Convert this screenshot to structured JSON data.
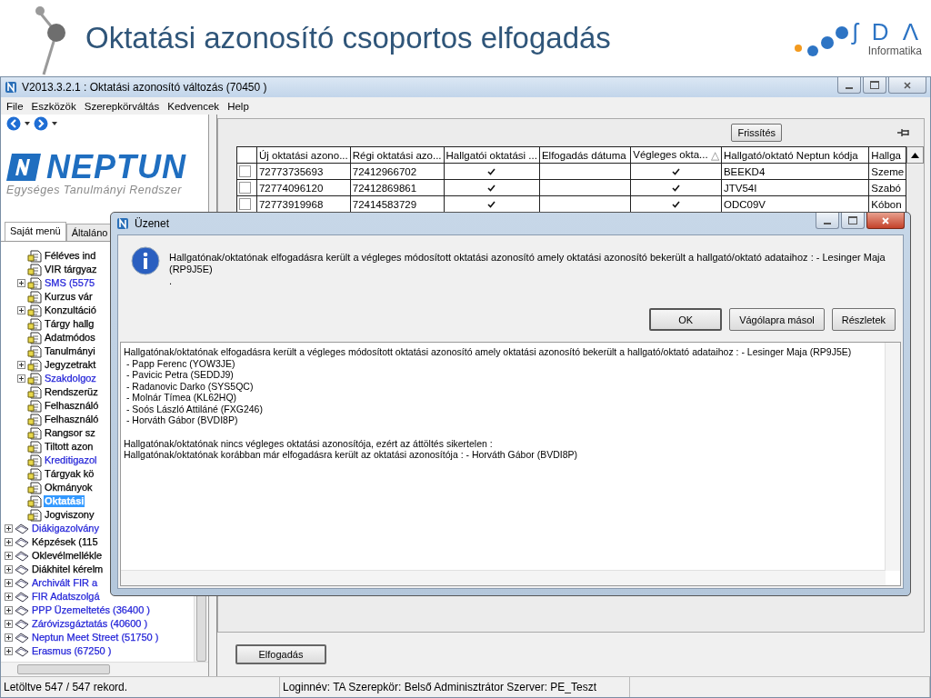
{
  "slide": {
    "title": "Oktatási azonosító csoportos elfogadás",
    "logo": {
      "letters": "ʃ D Λ",
      "subtitle": "Informatika"
    }
  },
  "window": {
    "title": "V2013.3.2.1 : Oktatási azonosító változás (70450  )",
    "menu": [
      "File",
      "Eszközök",
      "Szerepkörváltás",
      "Kedvencek",
      "Help"
    ]
  },
  "sidebar": {
    "brand": "NEPTUN",
    "tagline": "Egységes Tanulmányi Rendszer",
    "tabs": [
      {
        "label": "Saját menü",
        "selected": true
      },
      {
        "label": "Általáno",
        "selected": false
      }
    ],
    "tree": [
      {
        "kind": "menu",
        "label": "Féléves ind",
        "color": "#000000",
        "expandable": false,
        "selected": false
      },
      {
        "kind": "menu",
        "label": "VIR tárgyaz",
        "color": "#000000",
        "expandable": false,
        "selected": false
      },
      {
        "kind": "menu",
        "label": "SMS (5575",
        "color": "#2424d8",
        "expandable": true,
        "selected": false
      },
      {
        "kind": "menu",
        "label": "Kurzus vár",
        "color": "#000000",
        "expandable": false,
        "selected": false
      },
      {
        "kind": "menu",
        "label": "Konzultáció",
        "color": "#000000",
        "expandable": true,
        "selected": false
      },
      {
        "kind": "menu",
        "label": "Tárgy hallg",
        "color": "#000000",
        "expandable": false,
        "selected": false
      },
      {
        "kind": "menu",
        "label": "Adatmódos",
        "color": "#000000",
        "expandable": false,
        "selected": false
      },
      {
        "kind": "menu",
        "label": "Tanulmányi",
        "color": "#000000",
        "expandable": false,
        "selected": false
      },
      {
        "kind": "menu",
        "label": "Jegyzetrakt",
        "color": "#000000",
        "expandable": true,
        "selected": false
      },
      {
        "kind": "menu",
        "label": "Szakdolgoz",
        "color": "#2424d8",
        "expandable": true,
        "selected": false
      },
      {
        "kind": "menu",
        "label": "Rendszerüz",
        "color": "#000000",
        "expandable": false,
        "selected": false
      },
      {
        "kind": "menu",
        "label": "Felhasználó",
        "color": "#000000",
        "expandable": false,
        "selected": false
      },
      {
        "kind": "menu",
        "label": "Felhasználó",
        "color": "#000000",
        "expandable": false,
        "selected": false
      },
      {
        "kind": "menu",
        "label": "Rangsor sz",
        "color": "#000000",
        "expandable": false,
        "selected": false
      },
      {
        "kind": "menu",
        "label": "Tiltott azon",
        "color": "#000000",
        "expandable": false,
        "selected": false
      },
      {
        "kind": "menu",
        "label": "Kreditigazol",
        "color": "#2424d8",
        "expandable": false,
        "selected": false
      },
      {
        "kind": "menu",
        "label": "Tárgyak kö",
        "color": "#000000",
        "expandable": false,
        "selected": false
      },
      {
        "kind": "menu",
        "label": "Okmányok",
        "color": "#000000",
        "expandable": false,
        "selected": false
      },
      {
        "kind": "menu",
        "label": "Oktatási",
        "expandable": false,
        "selected": true
      },
      {
        "kind": "menu",
        "label": "Jogviszony",
        "color": "#000000",
        "expandable": false,
        "selected": false
      },
      {
        "kind": "module",
        "label": "Diákigazolvány",
        "color": "#2424d8",
        "expandable": true,
        "selected": false
      },
      {
        "kind": "module",
        "label": "Képzések (115",
        "color": "#000000",
        "expandable": true,
        "selected": false
      },
      {
        "kind": "module",
        "label": "Oklevélmellékle",
        "color": "#000000",
        "expandable": true,
        "selected": false
      },
      {
        "kind": "module",
        "label": "Diákhitel kérelm",
        "color": "#000000",
        "expandable": true,
        "selected": false
      },
      {
        "kind": "module",
        "label": "Archivált FIR a",
        "color": "#2424d8",
        "expandable": true,
        "selected": false
      },
      {
        "kind": "module",
        "label": "FIR Adatszolgá",
        "color": "#2424d8",
        "expandable": true,
        "selected": false
      },
      {
        "kind": "module",
        "label": "PPP Üzemeltetés (36400  )",
        "color": "#2424d8",
        "expandable": true,
        "selected": false
      },
      {
        "kind": "module",
        "label": "Záróvizsgáztatás (40600  )",
        "color": "#2424d8",
        "expandable": true,
        "selected": false
      },
      {
        "kind": "module",
        "label": "Neptun Meet Street (51750  )",
        "color": "#2424d8",
        "expandable": true,
        "selected": false
      },
      {
        "kind": "module",
        "label": "Erasmus (67250  )",
        "color": "#2424d8",
        "expandable": true,
        "selected": false
      }
    ]
  },
  "toolbar": {
    "refresh_button": "Frissítés"
  },
  "table": {
    "columns": [
      {
        "kind": "select"
      },
      {
        "kind": "text",
        "label": "Új oktatási azono..."
      },
      {
        "kind": "text",
        "label": "Régi oktatási azo..."
      },
      {
        "kind": "text",
        "label": "Hallgatói oktatási ..."
      },
      {
        "kind": "text",
        "label": "Elfogadás dátuma"
      },
      {
        "kind": "text",
        "label": "Végleges okta...",
        "sort_mark": "△"
      },
      {
        "kind": "text",
        "label": "Hallgató/oktató Neptun kódja"
      },
      {
        "kind": "text",
        "label": "Hallga"
      }
    ],
    "rows": [
      {
        "checked": false,
        "new_id": "72773735693",
        "old_id": "72412966702",
        "student_id_ok": true,
        "final": true,
        "code": "BEEKD4",
        "column_8": "Szeme"
      },
      {
        "checked": false,
        "new_id": "72774096120",
        "old_id": "72412869861",
        "student_id_ok": true,
        "final": true,
        "code": "JTV54I",
        "column_8": "Szabó"
      },
      {
        "checked": false,
        "new_id": "72773919968",
        "old_id": "72414583729",
        "student_id_ok": true,
        "final": true,
        "code": "ODC09V",
        "column_8": "Kóbon"
      }
    ]
  },
  "accept_button": "Elfogadás",
  "status_bar": {
    "records": "Letöltve 547 / 547 rekord.",
    "session": "Loginnév: TA   Szerepkör: Belső Adminisztrátor   Szerver: PE_Teszt"
  },
  "dialog": {
    "title": "Üzenet",
    "message": "Hallgatónak/oktatónak elfogadásra került a végleges módosított oktatási azonosító amely oktatási azonosító bekerült a hallgató/oktató adataihoz : - Lesinger Maja (RP9J5E)",
    "message_tail": ".",
    "buttons": [
      {
        "label": "OK",
        "default": true
      },
      {
        "label": "Vágólapra másol",
        "default": false
      },
      {
        "label": "Részletek",
        "default": false
      }
    ],
    "details": [
      {
        "lines": [
          "Hallgatónak/oktatónak elfogadásra került a végleges módosított oktatási azonosító amely oktatási azonosító bekerült a hallgató/oktató adataihoz : - Lesinger Maja (RP9J5E)",
          " - Papp Ferenc (YOW3JE)",
          " - Pavicic Petra (SEDDJ9)",
          " - Radanovic Darko (SYS5QC)",
          " - Molnár Tímea (KL62HQ)",
          " - Soós László Attiláné (FXG246)",
          " - Horváth Gábor (BVDI8P)"
        ]
      },
      {
        "lines": [
          "Hallgatónak/oktatónak nincs végleges oktatási azonosítója, ezért az áttöltés sikertelen :",
          "Hallgatónak/oktatónak korábban már elfogadásra került az oktatási azonosítója : - Horváth Gábor (BVDI8P)"
        ]
      }
    ]
  }
}
